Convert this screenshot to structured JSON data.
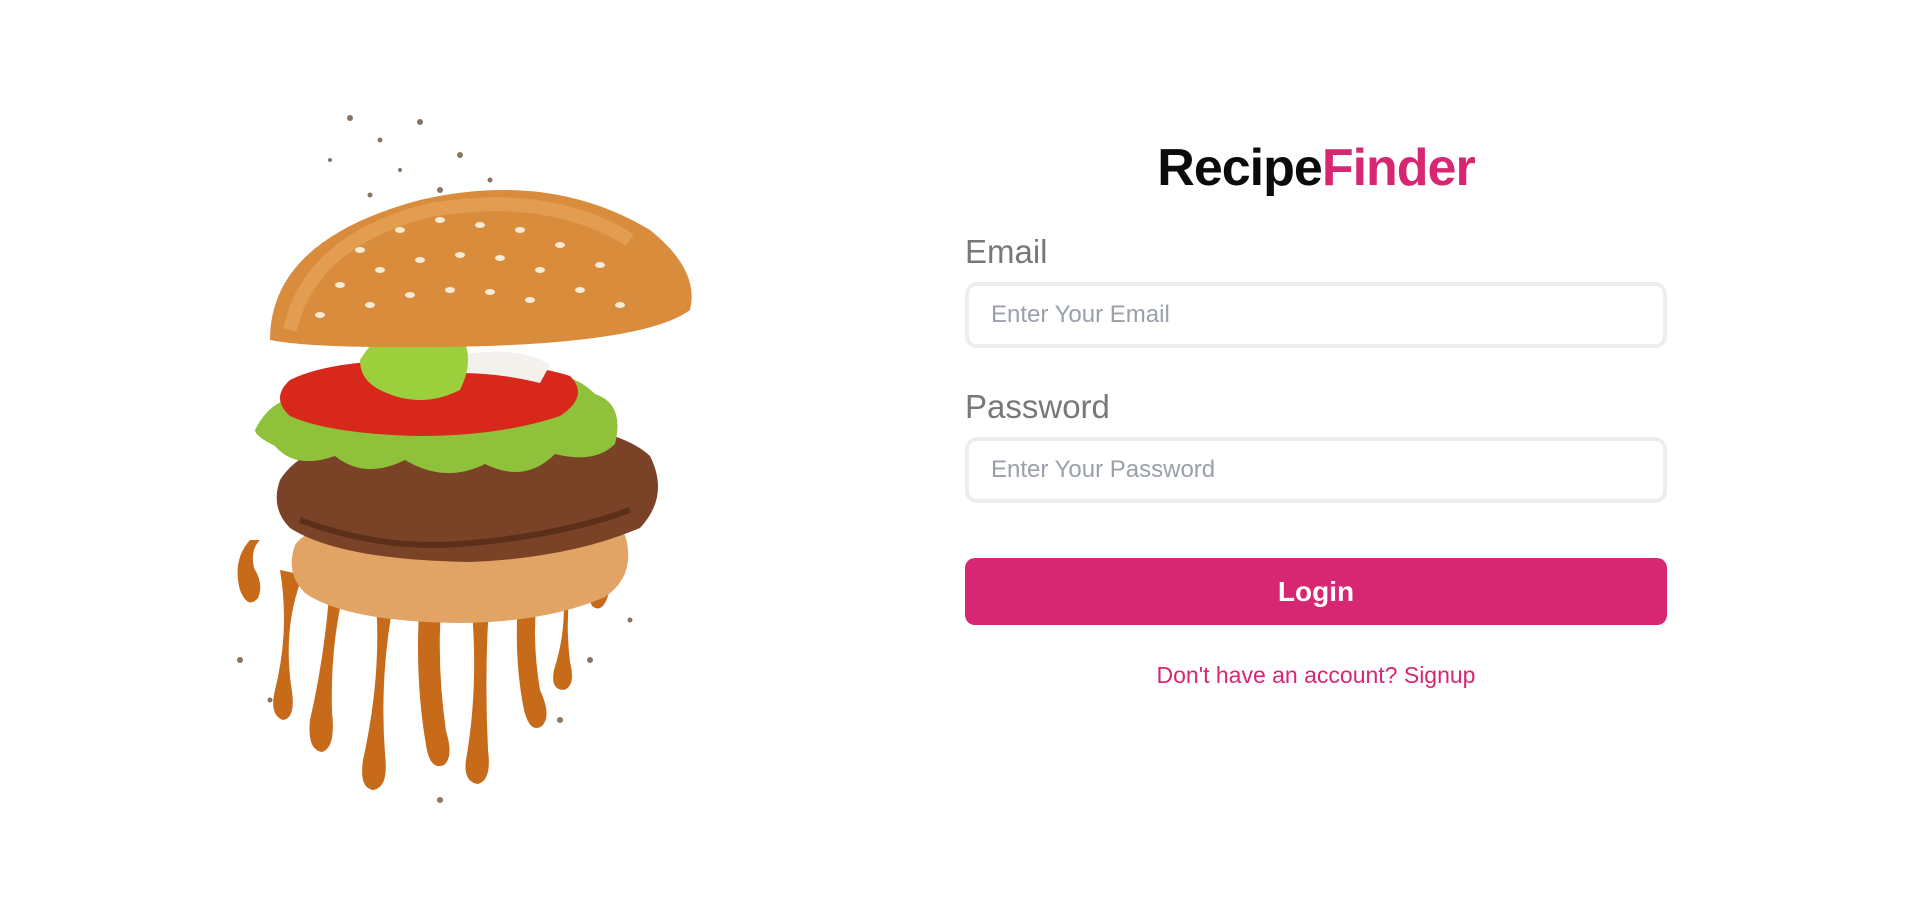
{
  "brand": {
    "part1": "Recipe",
    "part2": "Finder",
    "accent_color": "#d72672"
  },
  "hero": {
    "icon": "burger-illustration"
  },
  "login": {
    "email_label": "Email",
    "email_placeholder": "Enter Your Email",
    "email_value": "",
    "password_label": "Password",
    "password_placeholder": "Enter Your Password",
    "password_value": "",
    "submit_label": "Login",
    "signup_link": "Don't have an account? Signup"
  }
}
